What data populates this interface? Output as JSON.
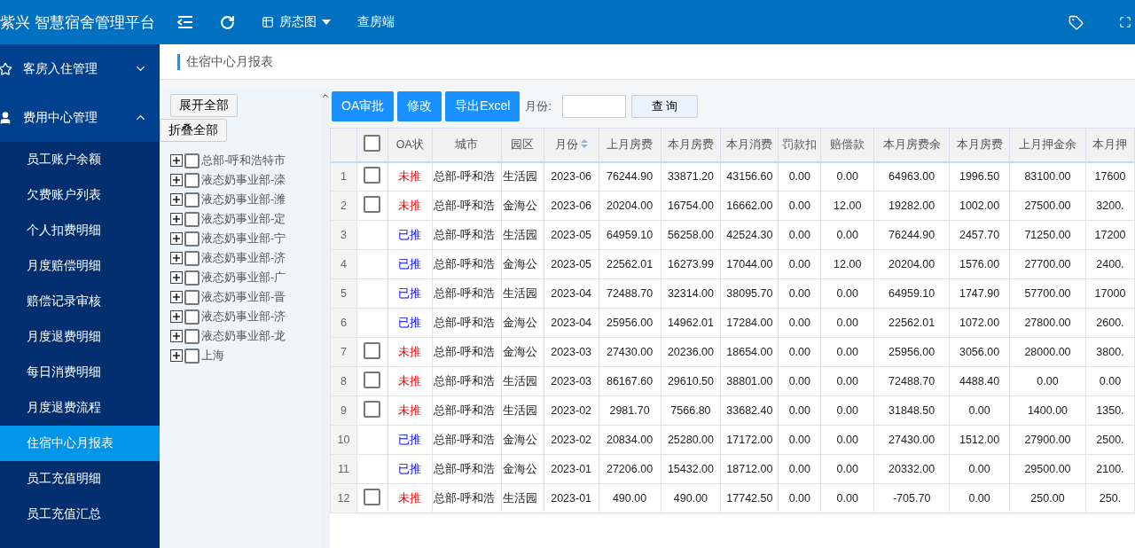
{
  "header": {
    "title": "紫兴 智慧宿舍管理平台",
    "nav": [
      {
        "label": "房态图",
        "dropdown": true
      },
      {
        "label": "查房端",
        "dropdown": false
      }
    ]
  },
  "sidebar": {
    "groups": [
      {
        "label": "客房入住管理",
        "expanded": false
      },
      {
        "label": "费用中心管理",
        "expanded": true,
        "items": [
          {
            "label": "员工账户余额",
            "selected": false
          },
          {
            "label": "欠费账户列表",
            "selected": false
          },
          {
            "label": "个人扣费明细",
            "selected": false
          },
          {
            "label": "月度赔偿明细",
            "selected": false
          },
          {
            "label": "赔偿记录审核",
            "selected": false
          },
          {
            "label": "月度退费明细",
            "selected": false
          },
          {
            "label": "每日消费明细",
            "selected": false
          },
          {
            "label": "月度退费流程",
            "selected": false
          },
          {
            "label": "住宿中心月报表",
            "selected": true
          },
          {
            "label": "员工充值明细",
            "selected": false
          },
          {
            "label": "员工充值汇总",
            "selected": false
          }
        ]
      }
    ]
  },
  "breadcrumb": "住宿中心月报表",
  "tree": {
    "buttons": [
      "展开全部",
      "折叠全部"
    ],
    "nodes": [
      {
        "label": "总部-呼和浩特市",
        "expanded": false,
        "checked": false
      },
      {
        "label": "液态奶事业部-滦",
        "expanded": false,
        "checked": false
      },
      {
        "label": "液态奶事业部-潍",
        "expanded": false,
        "checked": false
      },
      {
        "label": "液态奶事业部-定",
        "expanded": false,
        "checked": false
      },
      {
        "label": "液态奶事业部-宁",
        "expanded": false,
        "checked": false
      },
      {
        "label": "液态奶事业部-济",
        "expanded": false,
        "checked": false
      },
      {
        "label": "液态奶事业部-广",
        "expanded": false,
        "checked": false
      },
      {
        "label": "液态奶事业部-晋",
        "expanded": false,
        "checked": false
      },
      {
        "label": "液态奶事业部-济",
        "expanded": false,
        "checked": false
      },
      {
        "label": "液态奶事业部-龙",
        "expanded": false,
        "checked": false
      },
      {
        "label": "上海",
        "expanded": false,
        "checked": false
      }
    ]
  },
  "toolbar": {
    "buttons": [
      "OA审批",
      "修改",
      "导出Excel"
    ],
    "month_label": "月份:",
    "search_button": "查 询"
  },
  "table": {
    "header_checked": false,
    "columns": [
      {
        "label": "OA状",
        "sortable": false
      },
      {
        "label": "城市",
        "sortable": false
      },
      {
        "label": "园区",
        "sortable": false
      },
      {
        "label": "月份",
        "sortable": true
      },
      {
        "label": "上月房费",
        "sortable": false
      },
      {
        "label": "本月房费",
        "sortable": false
      },
      {
        "label": "本月消费",
        "sortable": false
      },
      {
        "label": "罚款扣",
        "sortable": false
      },
      {
        "label": "赔偿款",
        "sortable": false
      },
      {
        "label": "本月房费余",
        "sortable": false
      },
      {
        "label": "本月房费",
        "sortable": false
      },
      {
        "label": "上月押金余",
        "sortable": false
      },
      {
        "label": "本月押",
        "sortable": false
      }
    ],
    "rows": [
      {
        "index": "1",
        "kind": "pending",
        "checked": false,
        "cells": [
          "未推",
          "总部-呼和浩",
          "生活园",
          "2023-06",
          "76244.90",
          "33871.20",
          "43156.60",
          "0.00",
          "0.00",
          "64963.00",
          "1996.50",
          "83100.00",
          "17600"
        ]
      },
      {
        "index": "2",
        "kind": "pending",
        "checked": false,
        "cells": [
          "未推",
          "总部-呼和浩",
          "金海公",
          "2023-06",
          "20204.00",
          "16754.00",
          "16662.00",
          "0.00",
          "12.00",
          "19282.00",
          "1002.00",
          "27500.00",
          "3200."
        ]
      },
      {
        "index": "3",
        "kind": "pushed",
        "cells": [
          "已推",
          "总部-呼和浩",
          "生活园",
          "2023-05",
          "64959.10",
          "56258.00",
          "42524.30",
          "0.00",
          "0.00",
          "76244.90",
          "2457.70",
          "71250.00",
          "17200"
        ]
      },
      {
        "index": "4",
        "kind": "pushed",
        "cells": [
          "已推",
          "总部-呼和浩",
          "金海公",
          "2023-05",
          "22562.01",
          "16273.99",
          "17044.00",
          "0.00",
          "12.00",
          "20204.00",
          "1576.00",
          "27700.00",
          "2400."
        ]
      },
      {
        "index": "5",
        "kind": "pushed",
        "cells": [
          "已推",
          "总部-呼和浩",
          "生活园",
          "2023-04",
          "72488.70",
          "32314.00",
          "38095.70",
          "0.00",
          "0.00",
          "64959.10",
          "1747.90",
          "57700.00",
          "17000"
        ]
      },
      {
        "index": "6",
        "kind": "pushed",
        "cells": [
          "已推",
          "总部-呼和浩",
          "金海公",
          "2023-04",
          "25956.00",
          "14962.01",
          "17284.00",
          "0.00",
          "0.00",
          "22562.01",
          "1072.00",
          "27800.00",
          "2600."
        ]
      },
      {
        "index": "7",
        "kind": "pending",
        "checked": false,
        "cells": [
          "未推",
          "总部-呼和浩",
          "金海公",
          "2023-03",
          "27430.00",
          "20236.00",
          "18654.00",
          "0.00",
          "0.00",
          "25956.00",
          "3056.00",
          "28000.00",
          "3800."
        ]
      },
      {
        "index": "8",
        "kind": "pending",
        "checked": false,
        "cells": [
          "未推",
          "总部-呼和浩",
          "生活园",
          "2023-03",
          "86167.60",
          "29610.50",
          "38801.00",
          "0.00",
          "0.00",
          "72488.70",
          "4488.40",
          "0.00",
          "0.00"
        ]
      },
      {
        "index": "9",
        "kind": "pending",
        "checked": false,
        "cells": [
          "未推",
          "总部-呼和浩",
          "生活园",
          "2023-02",
          "2981.70",
          "7566.80",
          "33682.40",
          "0.00",
          "0.00",
          "31848.50",
          "0.00",
          "1400.00",
          "1350."
        ]
      },
      {
        "index": "10",
        "kind": "pushed",
        "cells": [
          "已推",
          "总部-呼和浩",
          "金海公",
          "2023-02",
          "20834.00",
          "25280.00",
          "17172.00",
          "0.00",
          "0.00",
          "27430.00",
          "1512.00",
          "27900.00",
          "2500."
        ]
      },
      {
        "index": "11",
        "kind": "pushed",
        "cells": [
          "已推",
          "总部-呼和浩",
          "金海公",
          "2023-01",
          "27206.00",
          "15432.00",
          "18712.00",
          "0.00",
          "0.00",
          "20332.00",
          "0.00",
          "29500.00",
          "2100."
        ]
      },
      {
        "index": "12",
        "kind": "pending",
        "checked": false,
        "cells": [
          "未推",
          "总部-呼和浩",
          "生活园",
          "2023-01",
          "490.00",
          "490.00",
          "17742.50",
          "0.00",
          "0.00",
          "-705.70",
          "0.00",
          "250.00",
          "250."
        ]
      }
    ]
  }
}
